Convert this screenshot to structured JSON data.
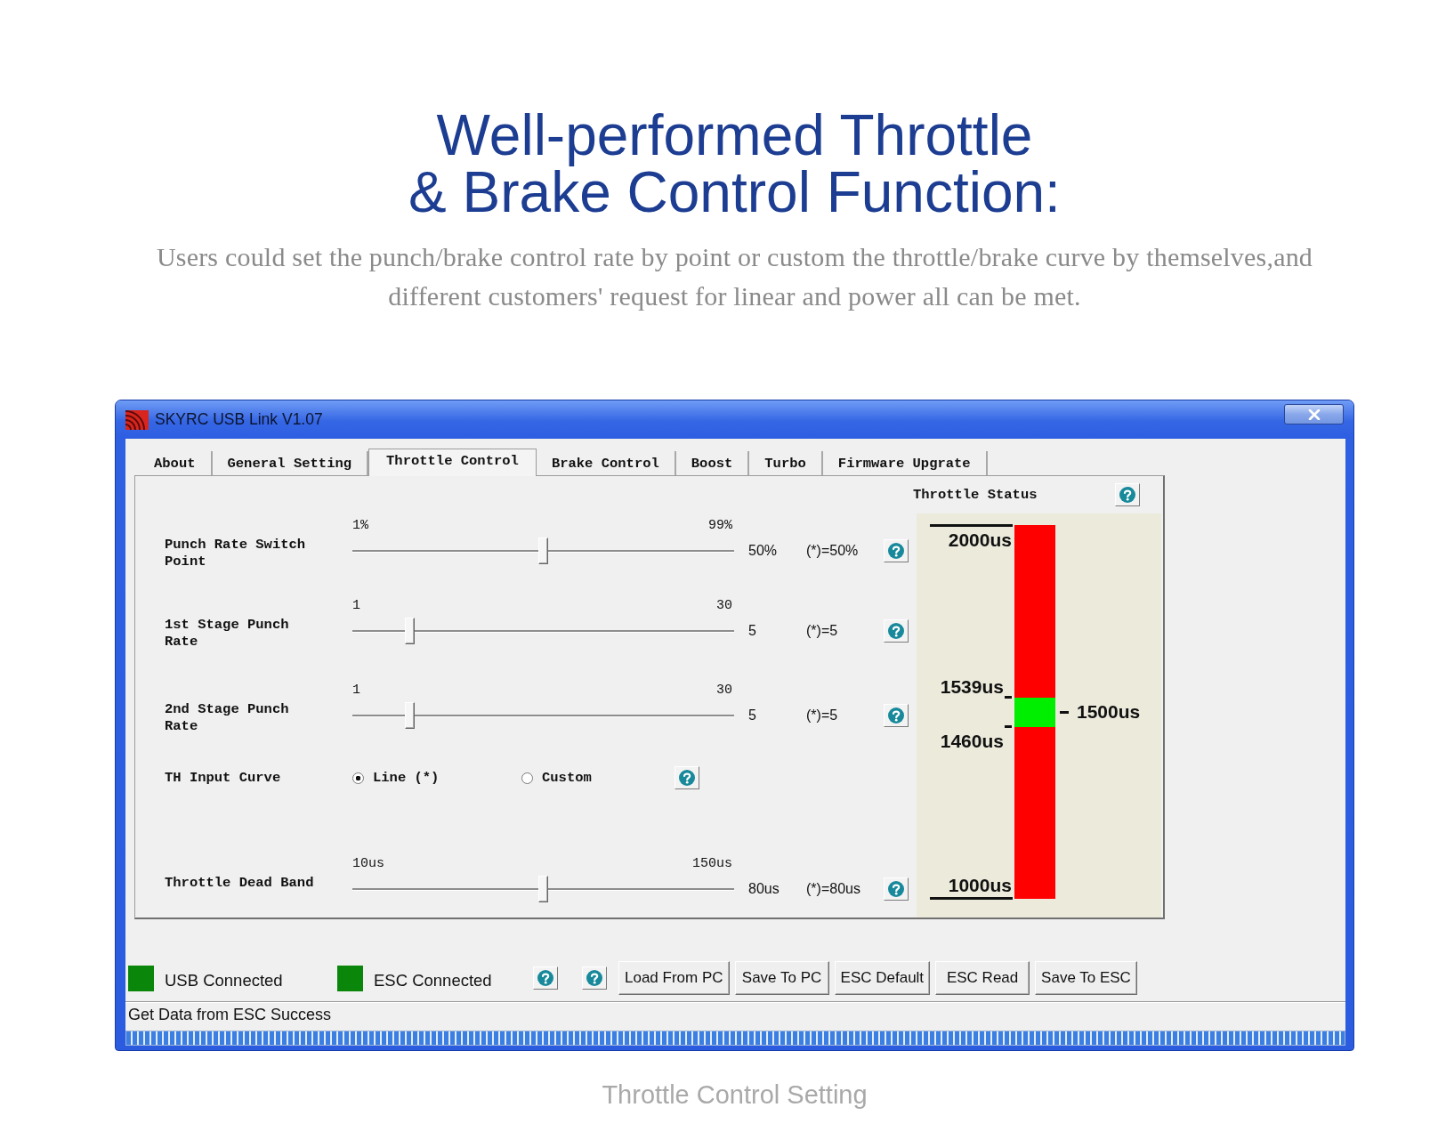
{
  "headline": [
    "Well-performed Throttle",
    "& Brake Control Function:"
  ],
  "subtitle": "Users could set the punch/brake control rate by point or custom the throttle/brake curve by themselves,and different customers' request for linear and power all can be met.",
  "window": {
    "title": "SKYRC USB Link V1.07"
  },
  "tabs": [
    {
      "label": "About",
      "selected": false
    },
    {
      "label": "General Setting",
      "selected": false
    },
    {
      "label": "Throttle Control",
      "selected": true
    },
    {
      "label": "Brake Control",
      "selected": false
    },
    {
      "label": "Boost",
      "selected": false
    },
    {
      "label": "Turbo",
      "selected": false
    },
    {
      "label": "Firmware Upgrate",
      "selected": false
    }
  ],
  "settings": [
    {
      "kind": "slider",
      "name": "Punch Rate Switch Point",
      "min": "1%",
      "max": "99%",
      "level": 0.5,
      "value": "50%",
      "default": "(*)=50%"
    },
    {
      "kind": "slider",
      "name": "1st Stage Punch Rate",
      "min": "1",
      "max": "30",
      "level": 0.14,
      "value": "5",
      "default": "(*)=5"
    },
    {
      "kind": "slider",
      "name": "2nd Stage Punch Rate",
      "min": "1",
      "max": "30",
      "level": 0.14,
      "value": "5",
      "default": "(*)=5"
    },
    {
      "kind": "radio",
      "name": "TH Input Curve",
      "options": [
        {
          "label": "Line (*)",
          "selected": true
        },
        {
          "label": "Custom",
          "selected": false
        }
      ]
    },
    {
      "kind": "slider",
      "name": "Throttle Dead Band",
      "min": "10us",
      "max": "150us",
      "level": 0.5,
      "value": "80us",
      "default": "(*)=80us"
    }
  ],
  "throttle_status": {
    "title": "Throttle Status",
    "scale_max": "2000us",
    "scale_min": "1000us",
    "neutral_upper": {
      "label": "1539us",
      "level": 0.539
    },
    "neutral_lower": {
      "label": "1460us",
      "level": 0.46
    },
    "neutral_point": {
      "label": "1500us",
      "level": 0.5
    }
  },
  "indicators": [
    {
      "label": "USB Connected",
      "on": true
    },
    {
      "label": "ESC Connected",
      "on": true
    }
  ],
  "buttons": [
    "Load From PC",
    "Save To PC",
    "ESC Default",
    "ESC Read",
    "Save To ESC"
  ],
  "status_bar": {
    "message": "Get Data from ESC Success",
    "progress": {
      "level": 1
    }
  },
  "caption": "Throttle Control Setting"
}
